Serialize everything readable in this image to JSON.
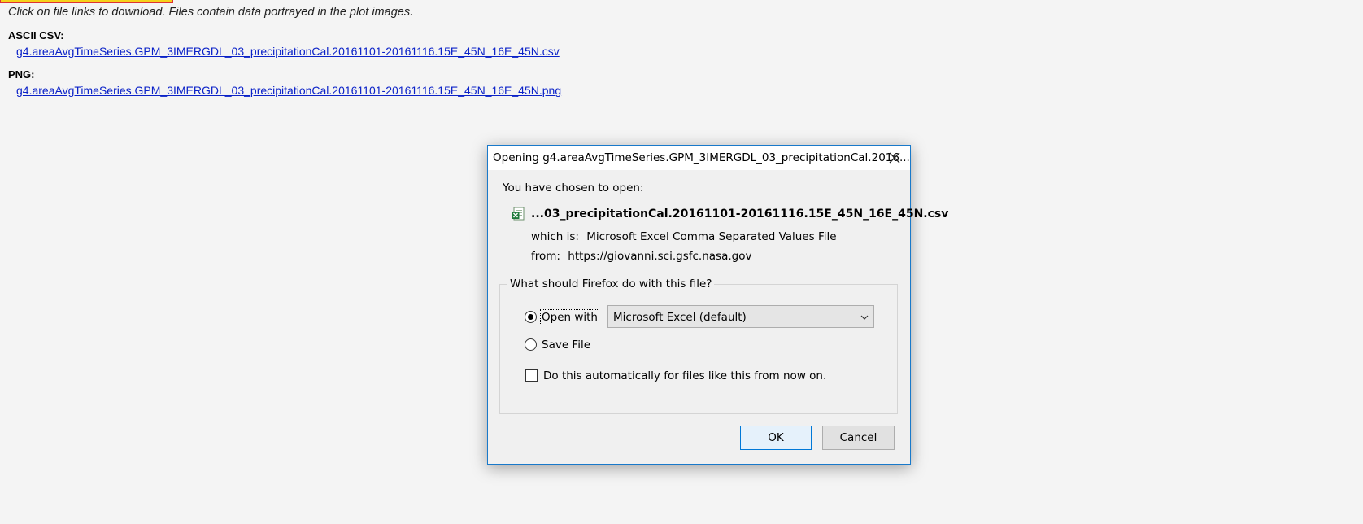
{
  "page": {
    "intro_text": "Click on file links to download. Files contain data portrayed in the plot images.",
    "sections": [
      {
        "label": "ASCII CSV:",
        "link": "g4.areaAvgTimeSeries.GPM_3IMERGDL_03_precipitationCal.20161101-20161116.15E_45N_16E_45N.csv"
      },
      {
        "label": "PNG:",
        "link": "g4.areaAvgTimeSeries.GPM_3IMERGDL_03_precipitationCal.20161101-20161116.15E_45N_16E_45N.png"
      }
    ]
  },
  "dialog": {
    "title": "Opening g4.areaAvgTimeSeries.GPM_3IMERGDL_03_precipitationCal.2016...",
    "chosen_label": "You have chosen to open:",
    "file_icon": "excel-csv-file-icon",
    "file_name": "...03_precipitationCal.20161101-20161116.15E_45N_16E_45N.csv",
    "which_is_label": "which is:",
    "which_is_value": "Microsoft Excel Comma Separated Values File",
    "from_label": "from:",
    "from_value": "https://giovanni.sci.gsfc.nasa.gov",
    "question": "What should Firefox do with this file?",
    "open_with_label": "Open with",
    "open_with_selected": true,
    "open_with_app": "Microsoft Excel (default)",
    "save_file_label": "Save File",
    "save_file_selected": false,
    "auto_label": "Do this automatically for files like this from now on.",
    "auto_checked": false,
    "ok_label": "OK",
    "cancel_label": "Cancel"
  },
  "colors": {
    "link": "#0b22c8",
    "dialog_border": "#1979ca",
    "ok_border": "#0078d7"
  }
}
